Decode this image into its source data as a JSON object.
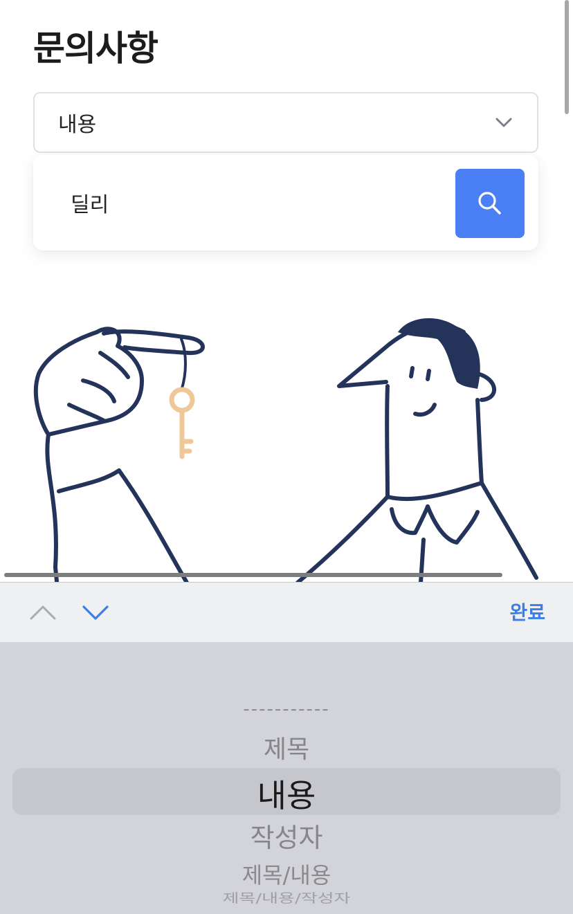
{
  "page": {
    "title": "문의사항"
  },
  "search": {
    "filter_selected": "내용",
    "query": "딜리",
    "button_icon": "search-icon"
  },
  "keyboard_toolbar": {
    "prev_icon": "chevron-up-icon",
    "next_icon": "chevron-down-icon",
    "done_label": "완료"
  },
  "picker": {
    "options": [
      "-----------",
      "제목",
      "내용",
      "작성자",
      "제목/내용",
      "제목/내용/작성자"
    ],
    "selected_index": 2
  },
  "colors": {
    "accent": "#4b7ff5",
    "done_text": "#3c7de8",
    "illustration_stroke": "#24335a",
    "key": "#eec899"
  }
}
